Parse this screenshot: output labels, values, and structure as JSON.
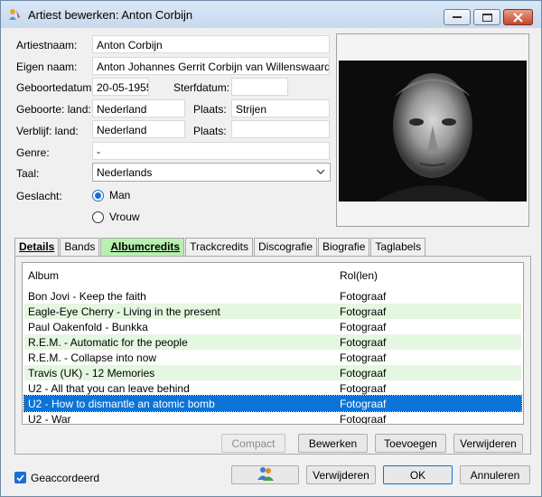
{
  "window": {
    "title": "Artiest bewerken: Anton Corbijn"
  },
  "form": {
    "artiestnaam_label": "Artiestnaam:",
    "artiestnaam": "Anton Corbijn",
    "eigen_naam_label": "Eigen naam:",
    "eigen_naam": "Anton Johannes Gerrit Corbijn van Willenswaard",
    "geboortedatum_label": "Geboortedatum:",
    "geboortedatum": "20-05-1955",
    "sterfdatum_label": "Sterfdatum:",
    "sterfdatum": "",
    "geboorte_land_label": "Geboorte: land:",
    "geboorte_land": "Nederland",
    "plaats_label": "Plaats:",
    "geboorte_plaats": "Strijen",
    "verblijf_land_label": "Verblijf: land:",
    "verblijf_land": "Nederland",
    "verblijf_plaats": "",
    "genre_label": "Genre:",
    "genre": "-",
    "taal_label": "Taal:",
    "taal": "Nederlands",
    "geslacht_label": "Geslacht:",
    "geslacht_options": [
      "Man",
      "Vrouw"
    ],
    "geslacht_selected": "Man"
  },
  "tabs": [
    {
      "label": "Details",
      "state": "selected-plain"
    },
    {
      "label": "Bands",
      "state": "normal"
    },
    {
      "label": "Albumcredits",
      "state": "active"
    },
    {
      "label": "Trackcredits",
      "state": "normal"
    },
    {
      "label": "Discografie",
      "state": "normal"
    },
    {
      "label": "Biografie",
      "state": "normal"
    },
    {
      "label": "Taglabels",
      "state": "normal"
    }
  ],
  "list": {
    "columns": [
      "Album",
      "Rol(len)"
    ],
    "rows": [
      {
        "album": "Bon Jovi - Keep the faith",
        "role": "Fotograaf"
      },
      {
        "album": "Eagle-Eye Cherry - Living in the present",
        "role": "Fotograaf"
      },
      {
        "album": "Paul Oakenfold - Bunkka",
        "role": "Fotograaf"
      },
      {
        "album": "R.E.M. - Automatic for the people",
        "role": "Fotograaf"
      },
      {
        "album": "R.E.M. - Collapse into now",
        "role": "Fotograaf"
      },
      {
        "album": "Travis (UK) - 12 Memories",
        "role": "Fotograaf"
      },
      {
        "album": "U2 - All that you can leave behind",
        "role": "Fotograaf"
      },
      {
        "album": "U2 - How to dismantle an atomic bomb",
        "role": "Fotograaf"
      },
      {
        "album": "U2 - War",
        "role": "Fotograaf"
      }
    ],
    "selected_index": 7
  },
  "panel_buttons": {
    "compact": "Compact",
    "bewerken": "Bewerken",
    "toevoegen": "Toevoegen",
    "verwijderen": "Verwijderen"
  },
  "footer": {
    "geaccordeerd": "Geaccordeerd",
    "geaccordeerd_checked": true,
    "people_icon": "people-icon",
    "verwijderen": "Verwijderen",
    "ok": "OK",
    "annuleren": "Annuleren"
  },
  "colors": {
    "accent": "#0a74d9",
    "active_tab": "#b8f0b0",
    "alt_row": "#e4f7e0"
  }
}
